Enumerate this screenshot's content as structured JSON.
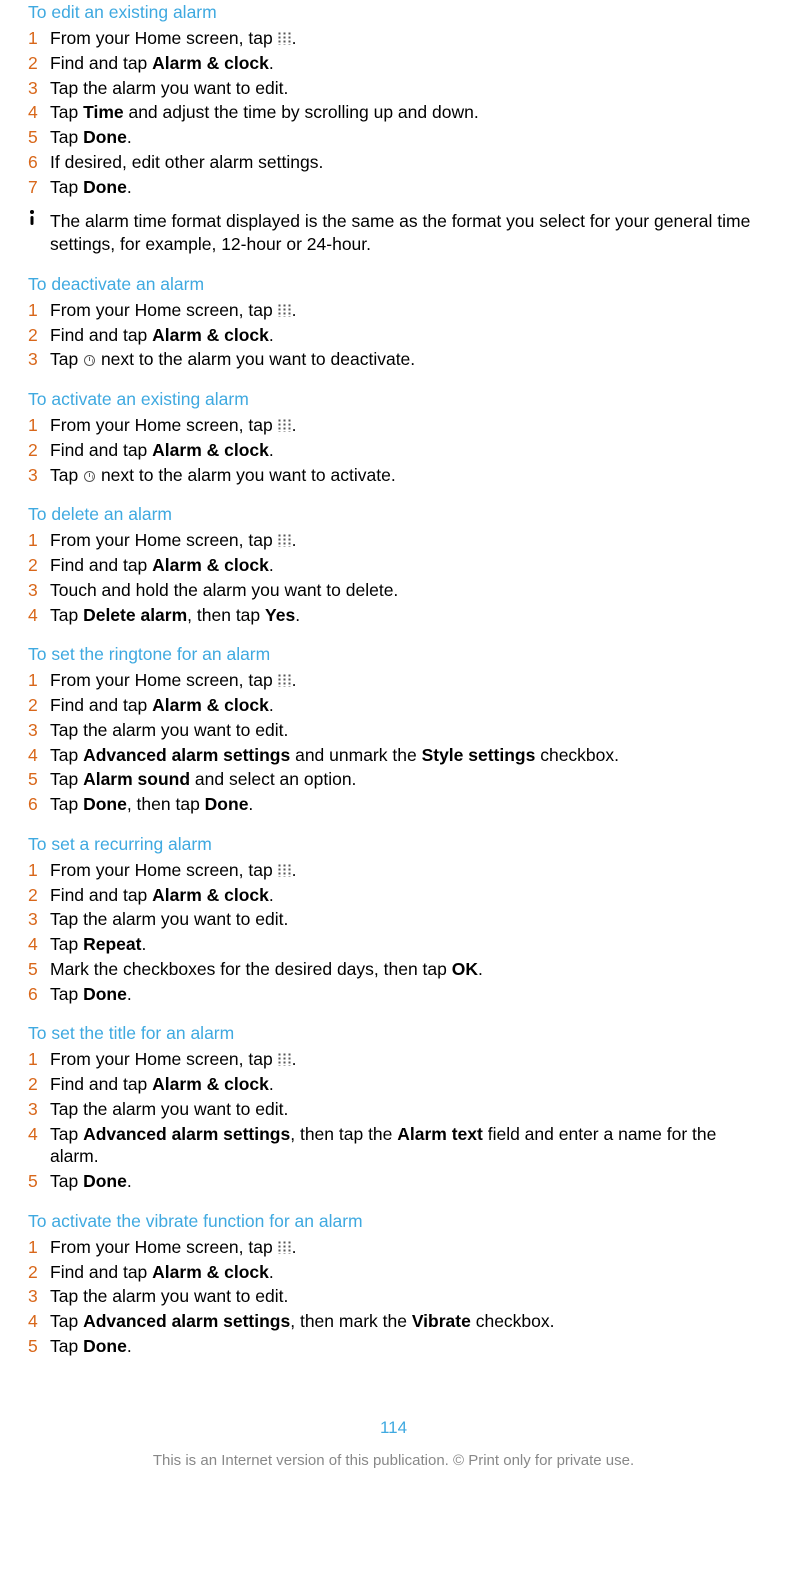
{
  "sections": [
    {
      "title": "To edit an existing alarm",
      "steps": [
        {
          "pre": "From your Home screen, tap ",
          "icon": "apps",
          "post": "."
        },
        {
          "segments": [
            {
              "t": "Find and tap "
            },
            {
              "t": "Alarm & clock",
              "b": true
            },
            {
              "t": "."
            }
          ]
        },
        {
          "segments": [
            {
              "t": "Tap the alarm you want to edit."
            }
          ]
        },
        {
          "segments": [
            {
              "t": "Tap "
            },
            {
              "t": "Time",
              "b": true
            },
            {
              "t": " and adjust the time by scrolling up and down."
            }
          ]
        },
        {
          "segments": [
            {
              "t": "Tap "
            },
            {
              "t": "Done",
              "b": true
            },
            {
              "t": "."
            }
          ]
        },
        {
          "segments": [
            {
              "t": "If desired, edit other alarm settings."
            }
          ]
        },
        {
          "segments": [
            {
              "t": "Tap "
            },
            {
              "t": "Done",
              "b": true
            },
            {
              "t": "."
            }
          ]
        }
      ],
      "note": "The alarm time format displayed is the same as the format you select for your general time settings, for example, 12-hour or 24-hour."
    },
    {
      "title": "To deactivate an alarm",
      "steps": [
        {
          "pre": "From your Home screen, tap ",
          "icon": "apps",
          "post": "."
        },
        {
          "segments": [
            {
              "t": "Find and tap "
            },
            {
              "t": "Alarm & clock",
              "b": true
            },
            {
              "t": "."
            }
          ]
        },
        {
          "pre": "Tap ",
          "icon": "alarm",
          "post": " next to the alarm you want to deactivate."
        }
      ]
    },
    {
      "title": "To activate an existing alarm",
      "steps": [
        {
          "pre": "From your Home screen, tap ",
          "icon": "apps",
          "post": "."
        },
        {
          "segments": [
            {
              "t": "Find and tap "
            },
            {
              "t": "Alarm & clock",
              "b": true
            },
            {
              "t": "."
            }
          ]
        },
        {
          "pre": "Tap ",
          "icon": "alarm",
          "post": " next to the alarm you want to activate."
        }
      ]
    },
    {
      "title": "To delete an alarm",
      "steps": [
        {
          "pre": "From your Home screen, tap ",
          "icon": "apps",
          "post": "."
        },
        {
          "segments": [
            {
              "t": "Find and tap "
            },
            {
              "t": "Alarm & clock",
              "b": true
            },
            {
              "t": "."
            }
          ]
        },
        {
          "segments": [
            {
              "t": "Touch and hold the alarm you want to delete."
            }
          ]
        },
        {
          "segments": [
            {
              "t": "Tap "
            },
            {
              "t": "Delete alarm",
              "b": true
            },
            {
              "t": ", then tap "
            },
            {
              "t": "Yes",
              "b": true
            },
            {
              "t": "."
            }
          ]
        }
      ]
    },
    {
      "title": "To set the ringtone for an alarm",
      "steps": [
        {
          "pre": "From your Home screen, tap ",
          "icon": "apps",
          "post": "."
        },
        {
          "segments": [
            {
              "t": "Find and tap "
            },
            {
              "t": "Alarm & clock",
              "b": true
            },
            {
              "t": "."
            }
          ]
        },
        {
          "segments": [
            {
              "t": "Tap the alarm you want to edit."
            }
          ]
        },
        {
          "segments": [
            {
              "t": "Tap "
            },
            {
              "t": "Advanced alarm settings",
              "b": true
            },
            {
              "t": " and unmark the "
            },
            {
              "t": "Style settings",
              "b": true
            },
            {
              "t": " checkbox."
            }
          ]
        },
        {
          "segments": [
            {
              "t": "Tap "
            },
            {
              "t": "Alarm sound",
              "b": true
            },
            {
              "t": " and select an option."
            }
          ]
        },
        {
          "segments": [
            {
              "t": "Tap "
            },
            {
              "t": "Done",
              "b": true
            },
            {
              "t": ", then tap "
            },
            {
              "t": "Done",
              "b": true
            },
            {
              "t": "."
            }
          ]
        }
      ]
    },
    {
      "title": "To set a recurring alarm",
      "steps": [
        {
          "pre": "From your Home screen, tap ",
          "icon": "apps",
          "post": "."
        },
        {
          "segments": [
            {
              "t": "Find and tap "
            },
            {
              "t": "Alarm & clock",
              "b": true
            },
            {
              "t": "."
            }
          ]
        },
        {
          "segments": [
            {
              "t": "Tap the alarm you want to edit."
            }
          ]
        },
        {
          "segments": [
            {
              "t": "Tap "
            },
            {
              "t": "Repeat",
              "b": true
            },
            {
              "t": "."
            }
          ]
        },
        {
          "segments": [
            {
              "t": "Mark the checkboxes for the desired days, then tap "
            },
            {
              "t": "OK",
              "b": true
            },
            {
              "t": "."
            }
          ]
        },
        {
          "segments": [
            {
              "t": "Tap "
            },
            {
              "t": "Done",
              "b": true
            },
            {
              "t": "."
            }
          ]
        }
      ]
    },
    {
      "title": "To set the title for an alarm",
      "steps": [
        {
          "pre": "From your Home screen, tap ",
          "icon": "apps",
          "post": "."
        },
        {
          "segments": [
            {
              "t": "Find and tap "
            },
            {
              "t": "Alarm & clock",
              "b": true
            },
            {
              "t": "."
            }
          ]
        },
        {
          "segments": [
            {
              "t": "Tap the alarm you want to edit."
            }
          ]
        },
        {
          "segments": [
            {
              "t": "Tap "
            },
            {
              "t": "Advanced alarm settings",
              "b": true
            },
            {
              "t": ", then tap the "
            },
            {
              "t": "Alarm text",
              "b": true
            },
            {
              "t": " field and enter a name for the alarm."
            }
          ]
        },
        {
          "segments": [
            {
              "t": "Tap "
            },
            {
              "t": "Done",
              "b": true
            },
            {
              "t": "."
            }
          ]
        }
      ]
    },
    {
      "title": "To activate the vibrate function for an alarm",
      "steps": [
        {
          "pre": "From your Home screen, tap ",
          "icon": "apps",
          "post": "."
        },
        {
          "segments": [
            {
              "t": "Find and tap "
            },
            {
              "t": "Alarm & clock",
              "b": true
            },
            {
              "t": "."
            }
          ]
        },
        {
          "segments": [
            {
              "t": "Tap the alarm you want to edit."
            }
          ]
        },
        {
          "segments": [
            {
              "t": "Tap "
            },
            {
              "t": "Advanced alarm settings",
              "b": true
            },
            {
              "t": ", then mark the "
            },
            {
              "t": "Vibrate",
              "b": true
            },
            {
              "t": " checkbox."
            }
          ]
        },
        {
          "segments": [
            {
              "t": "Tap "
            },
            {
              "t": "Done",
              "b": true
            },
            {
              "t": "."
            }
          ]
        }
      ]
    }
  ],
  "page_number": "114",
  "footer": "This is an Internet version of this publication. © Print only for private use."
}
